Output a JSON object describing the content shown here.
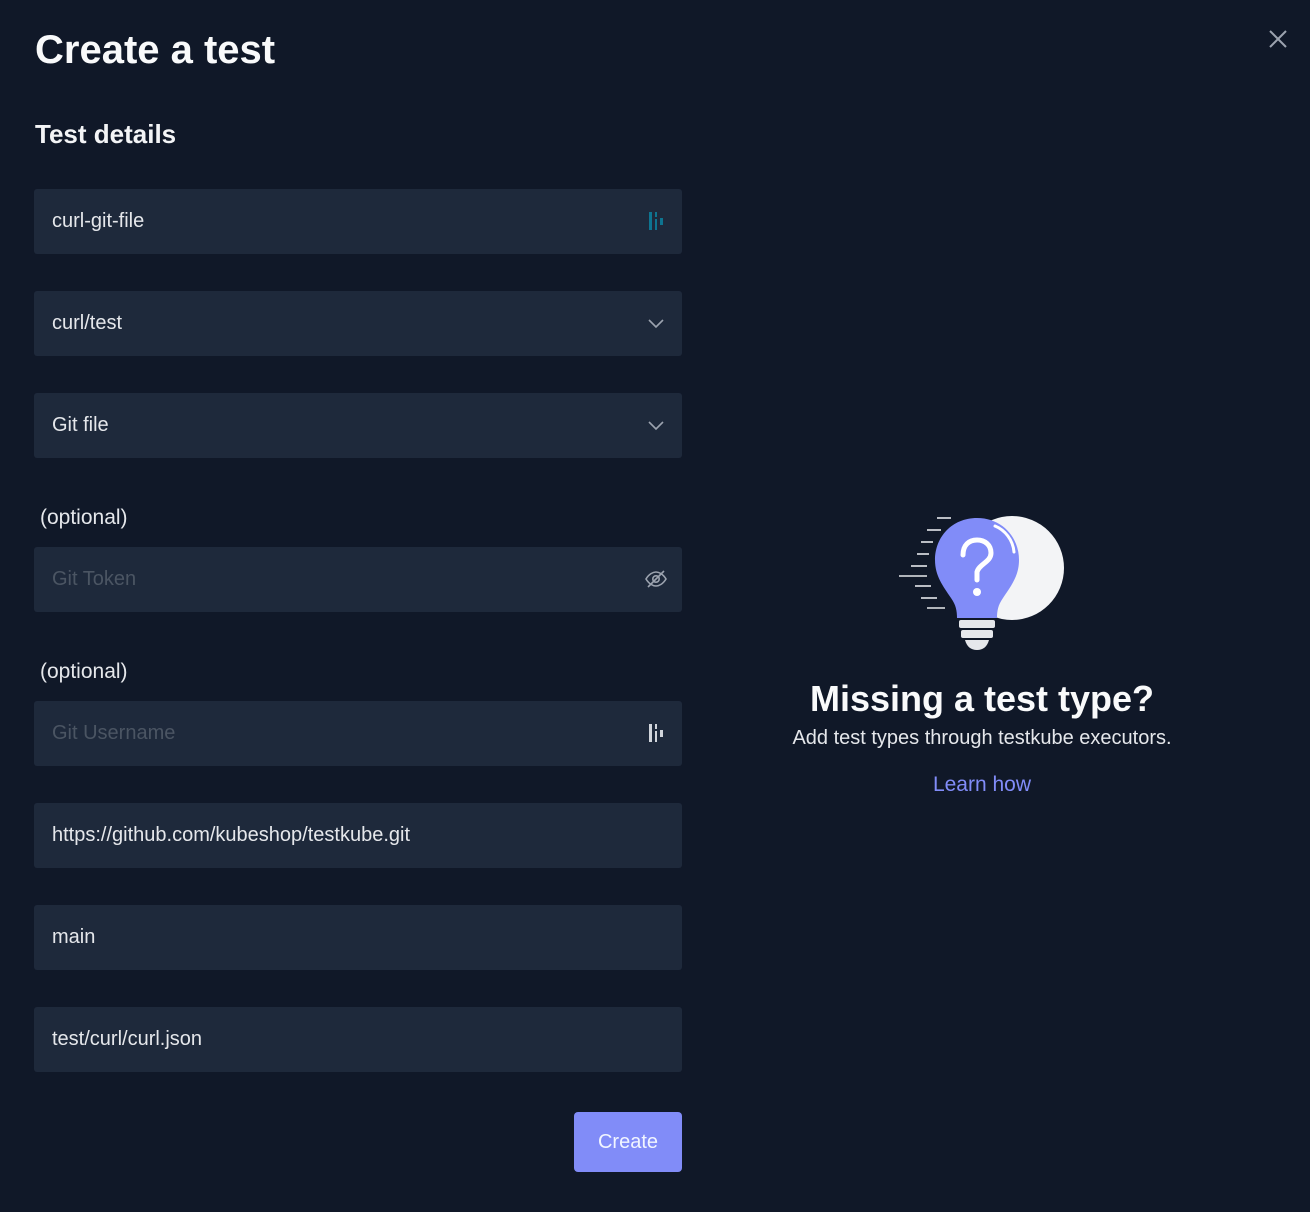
{
  "modal": {
    "title": "Create a test",
    "section_title": "Test details",
    "close_icon": "close-icon"
  },
  "fields": {
    "name": {
      "value": "curl-git-file",
      "icon": "password-manager-icon"
    },
    "type": {
      "value": "curl/test",
      "icon": "chevron-down-icon"
    },
    "source": {
      "value": "Git file",
      "icon": "chevron-down-icon"
    },
    "token": {
      "label": "(optional)",
      "placeholder": "Git Token",
      "icon": "eye-off-icon"
    },
    "username": {
      "label": "(optional)",
      "placeholder": "Git Username",
      "icon": "password-manager-icon"
    },
    "repo": {
      "value": "https://github.com/kubeshop/testkube.git"
    },
    "branch": {
      "value": "main"
    },
    "path": {
      "value": "test/curl/curl.json"
    }
  },
  "actions": {
    "create_label": "Create"
  },
  "help": {
    "title": "Missing a test type?",
    "text": "Add test types through testkube executors.",
    "link": "Learn how",
    "illustration": "lightbulb-question-icon"
  },
  "colors": {
    "background": "#101828",
    "field": "#1e293b",
    "accent": "#818cf8"
  }
}
